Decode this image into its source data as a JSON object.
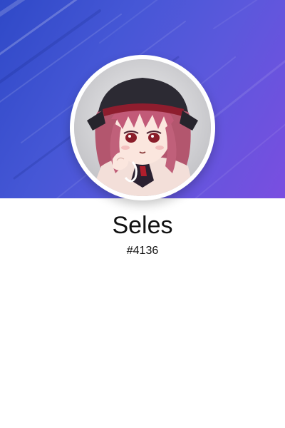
{
  "profile": {
    "username": "Seles",
    "discriminator": "#4136",
    "avatar_icon": "anime-avatar-icon"
  },
  "colors": {
    "banner_start": "#2f49c7",
    "banner_end": "#7a4ee0",
    "background": "#ffffff",
    "text": "#111111"
  }
}
